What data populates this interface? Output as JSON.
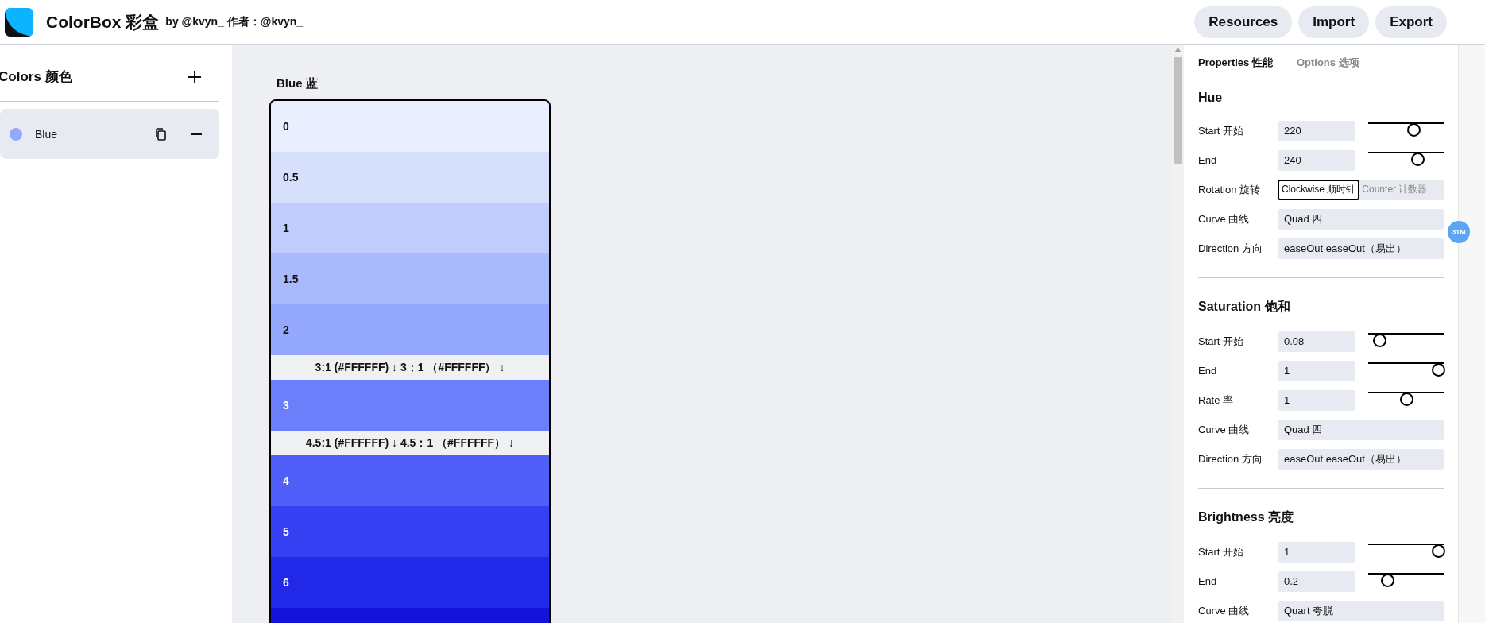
{
  "header": {
    "title": "ColorBox 彩盒",
    "byline": "by @kvyn_ 作者：@kvyn_",
    "buttons": [
      "Resources",
      "Import",
      "Export"
    ]
  },
  "sidebar": {
    "title": "Colors 颜色",
    "items": [
      {
        "name": "Blue",
        "color": "#94a8fd",
        "selected": true
      }
    ]
  },
  "palette": {
    "title": "Blue 蓝",
    "steps": [
      {
        "kind": "swatch",
        "label": "0",
        "color": "#e9efff"
      },
      {
        "kind": "swatch",
        "label": "0.5",
        "color": "#d6e0fd"
      },
      {
        "kind": "swatch",
        "label": "1",
        "color": "#bfccfc"
      },
      {
        "kind": "swatch",
        "label": "1.5",
        "color": "#a8b9fc"
      },
      {
        "kind": "swatch",
        "label": "2",
        "color": "#94a8fd"
      },
      {
        "kind": "contrast",
        "text": "3:1 (#FFFFFF) ↓ 3：1 （#FFFFFF） ↓"
      },
      {
        "kind": "swatch",
        "label": "3",
        "color": "#6b7ffa"
      },
      {
        "kind": "contrast",
        "text": "4.5:1 (#FFFFFF) ↓ 4.5：1 （#FFFFFF） ↓"
      },
      {
        "kind": "swatch",
        "label": "4",
        "color": "#4f5ff8"
      },
      {
        "kind": "swatch",
        "label": "5",
        "color": "#3540f2"
      },
      {
        "kind": "swatch",
        "label": "6",
        "color": "#2228e8"
      },
      {
        "kind": "swatch",
        "color": "#1313d9"
      }
    ]
  },
  "panel": {
    "tabs": [
      {
        "label": "Properties 性能",
        "selected": true
      },
      {
        "label": "Options 选项",
        "selected": false
      }
    ],
    "sections": [
      {
        "title": "Hue",
        "rows": [
          {
            "kind": "slider",
            "label": "Start 开始",
            "value": "220",
            "level": 0.61
          },
          {
            "kind": "slider",
            "label": "End",
            "value": "240",
            "level": 0.67
          },
          {
            "kind": "segmented",
            "label": "Rotation 旋转",
            "options": [
              {
                "label": "Clockwise 顺时针",
                "selected": true
              },
              {
                "label": "Counter 计数器",
                "selected": false
              }
            ]
          },
          {
            "kind": "select",
            "label": "Curve 曲线",
            "value": "Quad 四"
          },
          {
            "kind": "select",
            "label": "Direction 方向",
            "value": "easeOut easeOut（易出）"
          }
        ]
      },
      {
        "title": "Saturation 饱和",
        "rows": [
          {
            "kind": "slider",
            "label": "Start 开始",
            "value": "0.08",
            "level": 0.08
          },
          {
            "kind": "slider",
            "label": "End",
            "value": "1",
            "level": 1
          },
          {
            "kind": "slider",
            "label": "Rate 率",
            "value": "1",
            "level": 0.5
          },
          {
            "kind": "select",
            "label": "Curve 曲线",
            "value": "Quad 四"
          },
          {
            "kind": "select",
            "label": "Direction 方向",
            "value": "easeOut easeOut（易出）"
          }
        ]
      },
      {
        "title": "Brightness 亮度",
        "rows": [
          {
            "kind": "slider",
            "label": "Start 开始",
            "value": "1",
            "level": 1
          },
          {
            "kind": "slider",
            "label": "End",
            "value": "0.2",
            "level": 0.2
          },
          {
            "kind": "select",
            "label": "Curve 曲线",
            "value": "Quart 夸脱"
          }
        ]
      }
    ]
  },
  "badge": "31M"
}
